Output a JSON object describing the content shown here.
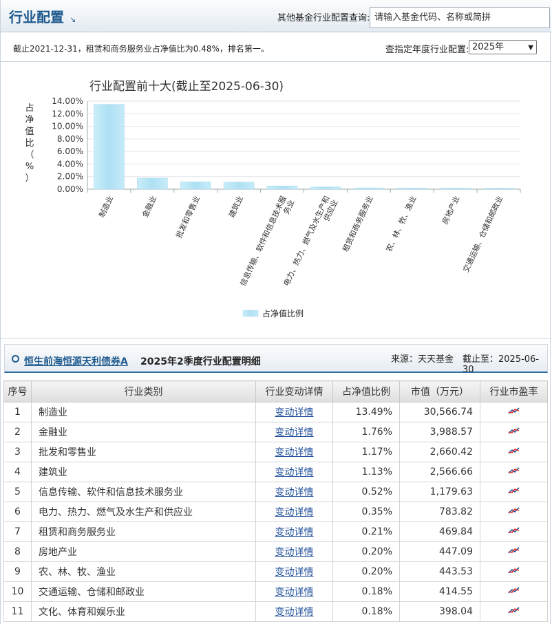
{
  "header": {
    "title": "行业配置",
    "query_label": "其他基金行业配置查询:",
    "search_placeholder": "请输入基金代码、名称或简拼"
  },
  "info": {
    "text": "截止2021-12-31，租赁和商务服务业占净值比为0.48%，排名第一。",
    "year_label": "查指定年度行业配置:",
    "year_value": "2025年"
  },
  "chart_data": {
    "type": "bar",
    "title": "行业配置前十大(截止至2025-06-30)",
    "ylabel": "占净值比（%）",
    "ylim": [
      0,
      14
    ],
    "yticks": [
      "0.00%",
      "2.00%",
      "4.00%",
      "6.00%",
      "8.00%",
      "10.00%",
      "12.00%",
      "14.00%"
    ],
    "categories": [
      "制造业",
      "金融业",
      "批发和零售业",
      "建筑业",
      "信息传输、软件和信息技术服务业",
      "电力、热力、燃气及水生产和供应业",
      "租赁和商务服务业",
      "农、林、牧、渔业",
      "房地产业",
      "交通运输、仓储和邮政业"
    ],
    "series": [
      {
        "name": "占净值比例",
        "values": [
          13.49,
          1.76,
          1.17,
          1.13,
          0.52,
          0.35,
          0.21,
          0.2,
          0.2,
          0.18
        ]
      }
    ],
    "legend_position": "bottom-center",
    "grid": true,
    "bar_color": "#bfe6f6"
  },
  "detail": {
    "fund_name": "恒生前海恒源天利债券A",
    "title": "2025年2季度行业配置明细",
    "source": "来源：天天基金",
    "as_of": "截止至：2025-06-30"
  },
  "table": {
    "headers": [
      "序号",
      "行业类别",
      "行业变动详情",
      "占净值比例",
      "市值（万元）",
      "行业市盈率"
    ],
    "link_text": "变动详情",
    "rows": [
      {
        "idx": "1",
        "name": "制造业",
        "pct": "13.49%",
        "value": "30,566.74"
      },
      {
        "idx": "2",
        "name": "金融业",
        "pct": "1.76%",
        "value": "3,988.57"
      },
      {
        "idx": "3",
        "name": "批发和零售业",
        "pct": "1.17%",
        "value": "2,660.42"
      },
      {
        "idx": "4",
        "name": "建筑业",
        "pct": "1.13%",
        "value": "2,566.66"
      },
      {
        "idx": "5",
        "name": "信息传输、软件和信息技术服务业",
        "pct": "0.52%",
        "value": "1,179.63"
      },
      {
        "idx": "6",
        "name": "电力、热力、燃气及水生产和供应业",
        "pct": "0.35%",
        "value": "783.82"
      },
      {
        "idx": "7",
        "name": "租赁和商务服务业",
        "pct": "0.21%",
        "value": "469.84"
      },
      {
        "idx": "8",
        "name": "房地产业",
        "pct": "0.20%",
        "value": "447.09"
      },
      {
        "idx": "9",
        "name": "农、林、牧、渔业",
        "pct": "0.20%",
        "value": "443.53"
      },
      {
        "idx": "10",
        "name": "交通运输、仓储和邮政业",
        "pct": "0.18%",
        "value": "414.55"
      },
      {
        "idx": "11",
        "name": "文化、体育和娱乐业",
        "pct": "0.18%",
        "value": "398.04"
      }
    ],
    "pe_icon": "line-chart-icon"
  }
}
